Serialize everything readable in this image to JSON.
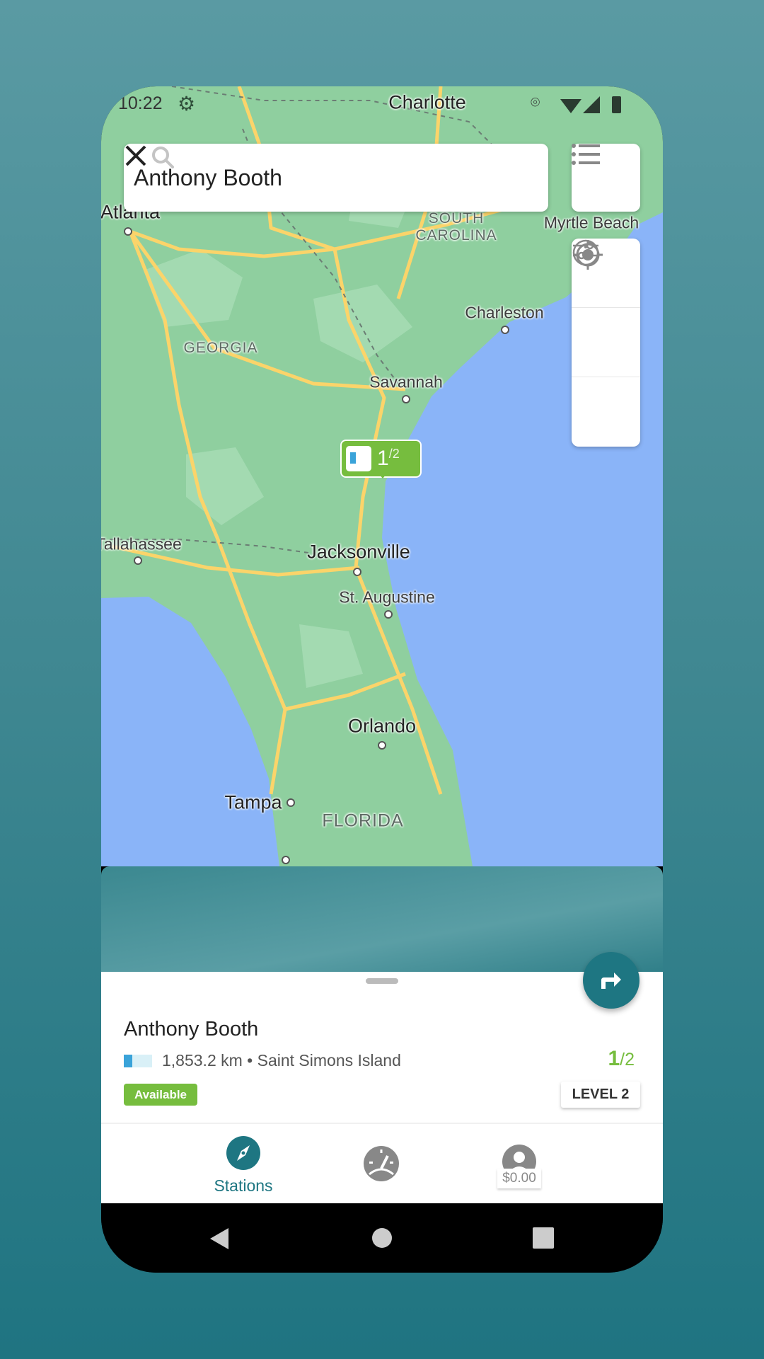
{
  "status_bar": {
    "time": "10:22",
    "icons": [
      "settings-icon",
      "location-icon",
      "wifi-icon",
      "signal-icon",
      "battery-icon"
    ]
  },
  "search": {
    "value": "Anthony Booth",
    "icon": "search-icon",
    "clear_icon": "close-icon"
  },
  "map": {
    "labels": {
      "charlotte": "Charlotte",
      "atlanta": "Atlanta",
      "south_carolina": "SOUTH CAROLINA",
      "myrtle_beach": "Myrtle Beach",
      "charleston": "Charleston",
      "georgia": "GEORGIA",
      "savannah": "Savannah",
      "tallahassee": "Tallahassee",
      "jacksonville": "Jacksonville",
      "st_augustine": "St. Augustine",
      "orlando": "Orlando",
      "tampa": "Tampa",
      "florida": "FLORIDA"
    },
    "marker": {
      "available": "1",
      "total": "/2"
    }
  },
  "colors": {
    "accent": "#1e7682",
    "available": "#76bd3e",
    "land": "#8fcf9f",
    "water": "#8ab4f8",
    "road": "#fbd46a"
  },
  "station": {
    "name": "Anthony Booth",
    "distance_location": "1,853.2 km • Saint Simons Island",
    "status": "Available",
    "available": "1",
    "total": "/2",
    "level": "LEVEL 2"
  },
  "bottom_nav": {
    "stations": "Stations",
    "balance": "$0.00"
  }
}
